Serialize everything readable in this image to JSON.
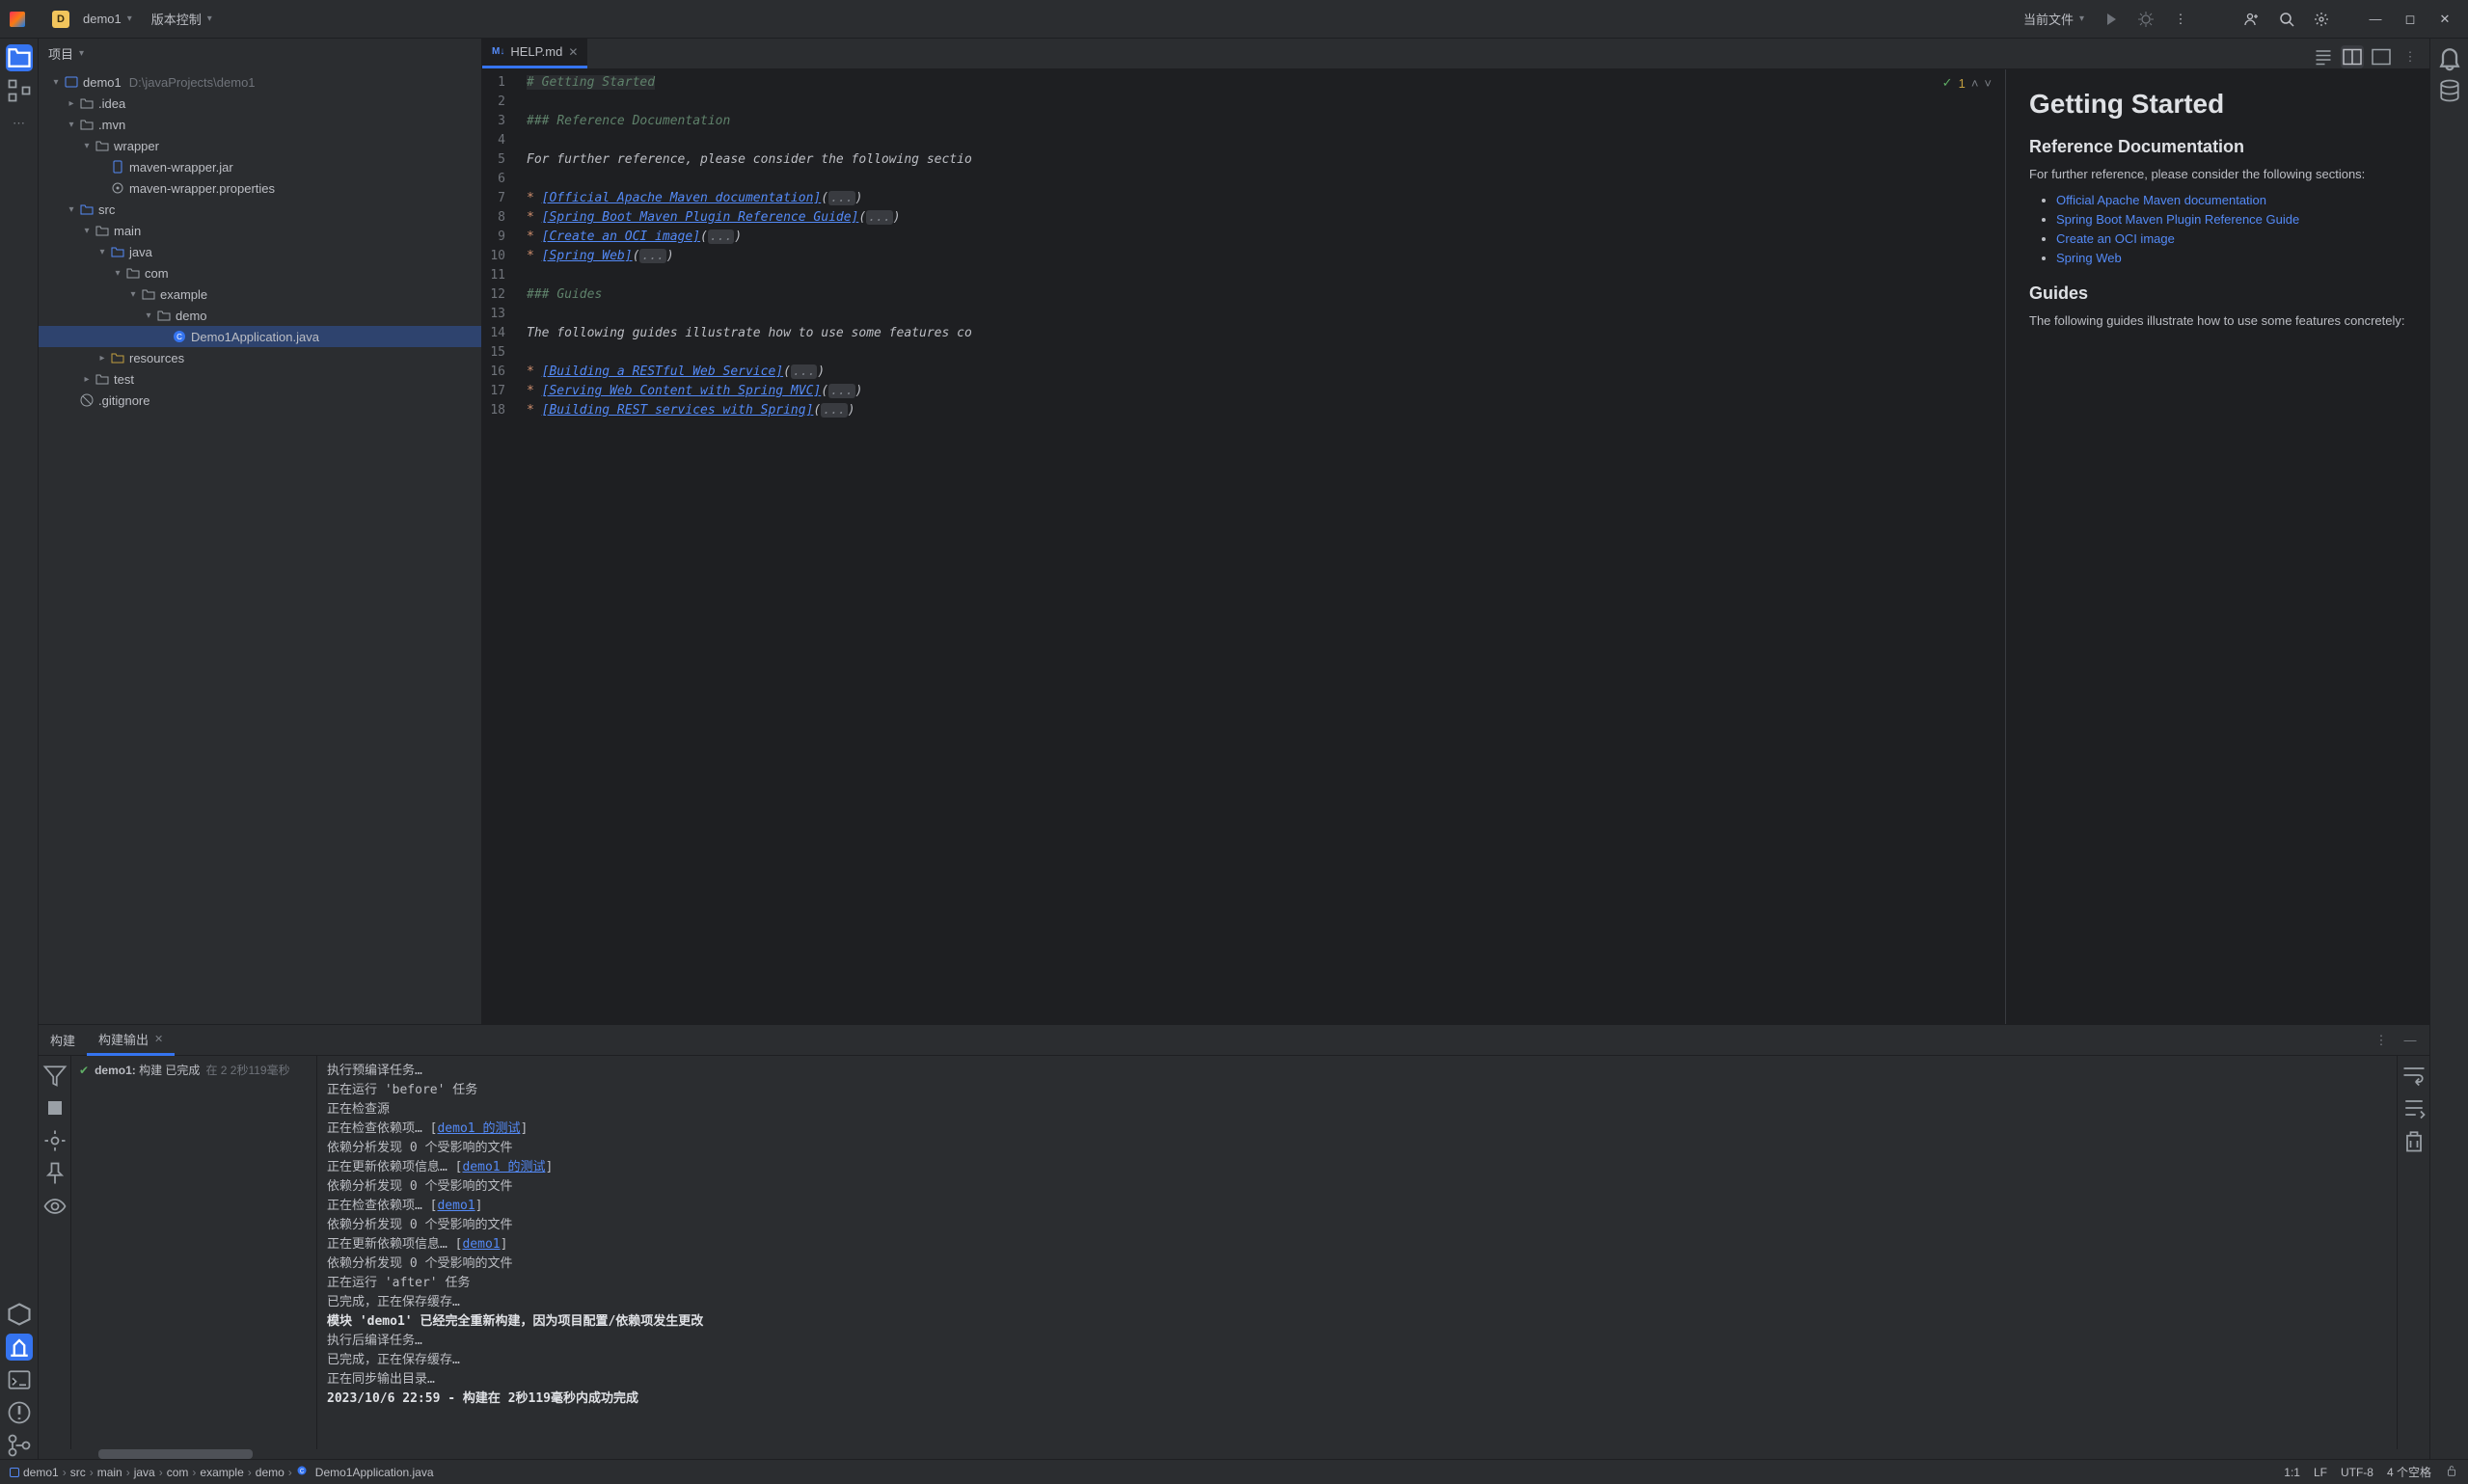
{
  "titlebar": {
    "project_initial": "D",
    "project_name": "demo1",
    "vcs_label": "版本控制",
    "current_file_label": "当前文件"
  },
  "left_stripe": {
    "items": [
      "project",
      "structure",
      "more"
    ],
    "bottom_items": [
      "services",
      "actions",
      "terminal",
      "problems",
      "git"
    ],
    "active_bottom_index": 1
  },
  "project": {
    "title": "项目"
  },
  "tree": {
    "root": {
      "name": "demo1",
      "hint": "D:\\javaProjects\\demo1"
    }
  },
  "tree_items": [
    {
      "depth": 0,
      "arrow": "down",
      "icon": "module",
      "label": "demo1",
      "hint": "D:\\javaProjects\\demo1"
    },
    {
      "depth": 1,
      "arrow": "right",
      "icon": "folder",
      "label": ".idea"
    },
    {
      "depth": 1,
      "arrow": "down",
      "icon": "folder",
      "label": ".mvn"
    },
    {
      "depth": 2,
      "arrow": "down",
      "icon": "folder",
      "label": "wrapper"
    },
    {
      "depth": 3,
      "arrow": "",
      "icon": "jar",
      "label": "maven-wrapper.jar"
    },
    {
      "depth": 3,
      "arrow": "",
      "icon": "props",
      "label": "maven-wrapper.properties"
    },
    {
      "depth": 1,
      "arrow": "down",
      "icon": "source-folder",
      "label": "src"
    },
    {
      "depth": 2,
      "arrow": "down",
      "icon": "folder",
      "label": "main"
    },
    {
      "depth": 3,
      "arrow": "down",
      "icon": "source-folder",
      "label": "java"
    },
    {
      "depth": 4,
      "arrow": "down",
      "icon": "package",
      "label": "com"
    },
    {
      "depth": 5,
      "arrow": "down",
      "icon": "package",
      "label": "example"
    },
    {
      "depth": 6,
      "arrow": "down",
      "icon": "package",
      "label": "demo"
    },
    {
      "depth": 7,
      "arrow": "",
      "icon": "java",
      "label": "Demo1Application.java",
      "selected": true
    },
    {
      "depth": 3,
      "arrow": "right",
      "icon": "resources",
      "label": "resources"
    },
    {
      "depth": 2,
      "arrow": "right",
      "icon": "folder",
      "label": "test"
    },
    {
      "depth": 1,
      "arrow": "",
      "icon": "gitignore",
      "label": ".gitignore"
    }
  ],
  "editor": {
    "tab_label": "HELP.md",
    "tab_icon_label": "M↓",
    "inspection": {
      "ok": "✓",
      "warn": "1"
    }
  },
  "code_lines": [
    {
      "n": 1,
      "html": "<span class='md-h1'># </span><span class='md-h1'>Getting Started</span>"
    },
    {
      "n": 2,
      "html": ""
    },
    {
      "n": 3,
      "html": "<span class='md-h'>### </span><span class='md-h'>Reference Documentation</span>"
    },
    {
      "n": 4,
      "html": ""
    },
    {
      "n": 5,
      "html": "<span class='md-text'>For further reference, please consider the following sectio</span>"
    },
    {
      "n": 6,
      "html": ""
    },
    {
      "n": 7,
      "html": "<span class='md-star'>* </span><span class='md-link'>[Official Apache Maven documentation]</span><span class='md-text'>(</span><span class='md-fold'>...</span><span class='md-text'>)</span>"
    },
    {
      "n": 8,
      "html": "<span class='md-star'>* </span><span class='md-link'>[Spring Boot Maven Plugin Reference Guide]</span><span class='md-text'>(</span><span class='md-fold'>...</span><span class='md-text'>)</span>"
    },
    {
      "n": 9,
      "html": "<span class='md-star'>* </span><span class='md-link'>[Create an OCI image]</span><span class='md-text'>(</span><span class='md-fold'>...</span><span class='md-text'>)</span>"
    },
    {
      "n": 10,
      "html": "<span class='md-star'>* </span><span class='md-link'>[Spring Web]</span><span class='md-text'>(</span><span class='md-fold'>...</span><span class='md-text'>)</span>"
    },
    {
      "n": 11,
      "html": ""
    },
    {
      "n": 12,
      "html": "<span class='md-h'>### </span><span class='md-h'>Guides</span>"
    },
    {
      "n": 13,
      "html": ""
    },
    {
      "n": 14,
      "html": "<span class='md-text'>The following guides illustrate how to use some features co</span>"
    },
    {
      "n": 15,
      "html": ""
    },
    {
      "n": 16,
      "html": "<span class='md-star'>* </span><span class='md-link'>[Building a RESTful Web Service]</span><span class='md-text'>(</span><span class='md-fold'>...</span><span class='md-text'>)</span>"
    },
    {
      "n": 17,
      "html": "<span class='md-star'>* </span><span class='md-link'>[Serving Web Content with Spring MVC]</span><span class='md-text'>(</span><span class='md-fold'>...</span><span class='md-text'>)</span>"
    },
    {
      "n": 18,
      "html": "<span class='md-star'>* </span><span class='md-link'>[Building REST services with Spring]</span><span class='md-text'>(</span><span class='md-fold'>...</span><span class='md-text'>)</span>"
    }
  ],
  "preview": {
    "h1": "Getting Started",
    "h3a": "Reference Documentation",
    "p1": "For further reference, please consider the following sections:",
    "links1": [
      "Official Apache Maven documentation",
      "Spring Boot Maven Plugin Reference Guide",
      "Create an OCI image",
      "Spring Web"
    ],
    "h3b": "Guides",
    "p2": "The following guides illustrate how to use some features concretely:"
  },
  "build": {
    "tab_build": "构建",
    "tab_output": "构建输出",
    "status_project": "demo1:",
    "status_text": "构建 已完成",
    "status_time": "在 2 2秒119毫秒"
  },
  "build_output": [
    {
      "t": "执行预编译任务…"
    },
    {
      "t": "正在运行 'before' 任务"
    },
    {
      "t": "正在检查源"
    },
    {
      "t": "正在检查依赖项… [",
      "link": "demo1 的测试",
      "after": "]"
    },
    {
      "t": "依赖分析发现 0 个受影响的文件"
    },
    {
      "t": "正在更新依赖项信息… [",
      "link": "demo1 的测试",
      "after": "]"
    },
    {
      "t": "依赖分析发现 0 个受影响的文件"
    },
    {
      "t": "正在检查依赖项… [",
      "link": "demo1",
      "after": "]"
    },
    {
      "t": "依赖分析发现 0 个受影响的文件"
    },
    {
      "t": "正在更新依赖项信息… [",
      "link": "demo1",
      "after": "]"
    },
    {
      "t": "依赖分析发现 0 个受影响的文件"
    },
    {
      "t": "正在运行 'after' 任务"
    },
    {
      "t": "已完成，正在保存缓存…"
    },
    {
      "bold": true,
      "t": "模块 'demo1' 已经完全重新构建，因为项目配置/依赖项发生更改"
    },
    {
      "t": "执行后编译任务…"
    },
    {
      "t": "已完成，正在保存缓存…"
    },
    {
      "t": "正在同步输出目录…"
    },
    {
      "bold": true,
      "t": "2023/10/6 22:59 - 构建在 2秒119毫秒内成功完成"
    }
  ],
  "breadcrumbs": [
    "demo1",
    "src",
    "main",
    "java",
    "com",
    "example",
    "demo",
    "Demo1Application.java"
  ],
  "status": {
    "pos": "1:1",
    "sep1": "LF",
    "enc": "UTF-8",
    "indent": "4 个空格"
  }
}
